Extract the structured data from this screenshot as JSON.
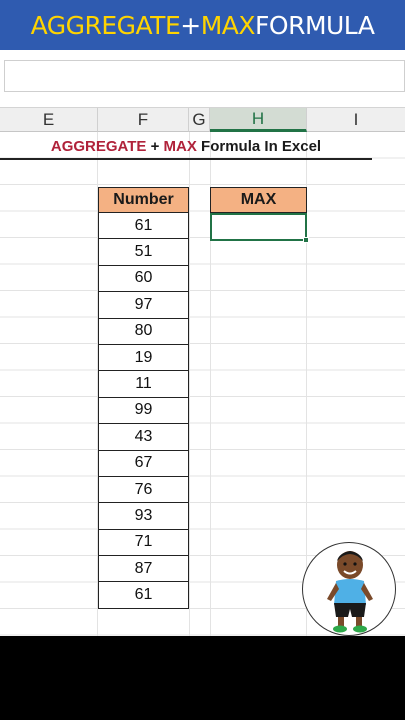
{
  "banner": {
    "part1": "AGGREGATE",
    "part2": " + ",
    "part3": "MAX",
    "part4": " FORMULA"
  },
  "columns": [
    "E",
    "F",
    "G",
    "H",
    "I"
  ],
  "selected_column": "H",
  "title": {
    "part1": "AGGREGATE",
    "part2": " + ",
    "part3": "MAX",
    "part4": " Formula In Excel"
  },
  "table": {
    "number_header": "Number",
    "max_header": "MAX",
    "values": [
      "61",
      "51",
      "60",
      "97",
      "80",
      "19",
      "11",
      "99",
      "43",
      "67",
      "76",
      "93",
      "71",
      "87",
      "61"
    ]
  },
  "colors": {
    "banner_bg": "#2f5bb0",
    "accent_yellow": "#ffd400",
    "header_fill": "#f4b183",
    "excel_green": "#217346",
    "title_red": "#b0223a"
  }
}
